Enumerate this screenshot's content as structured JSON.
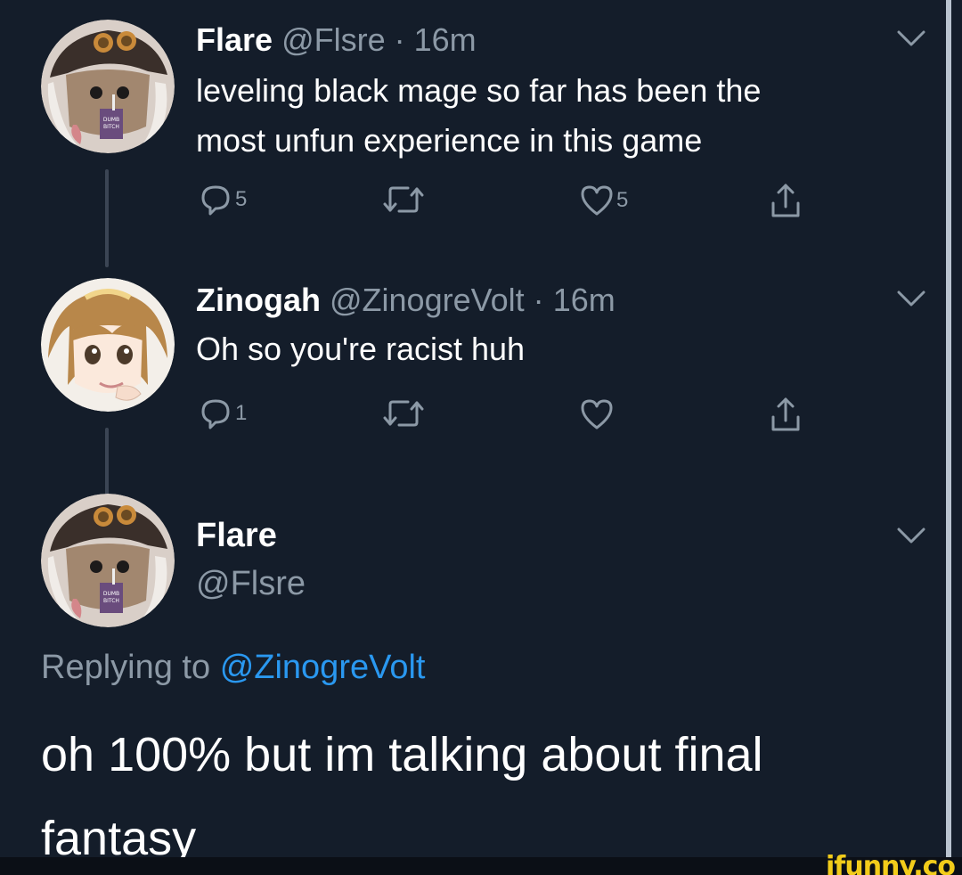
{
  "tweet1": {
    "name": "Flare",
    "handle": "@Flsre",
    "separator": "·",
    "time": "16m",
    "text_line1": "leveling black mage so far has been the",
    "text_line2": "most unfun experience in this game",
    "reply_count": "5",
    "like_count": "5",
    "avatar_label": "DUMB BITCH JUICE"
  },
  "tweet2": {
    "name": "Zinogah",
    "handle": "@ZinogreVolt",
    "separator": "·",
    "time": "16m",
    "text": "Oh so you're racist huh",
    "reply_count": "1"
  },
  "tweet3": {
    "name": "Flare",
    "handle": "@Flsre",
    "replying_prefix": "Replying to",
    "replying_mention": "@ZinogreVolt",
    "text_line1": "oh 100% but im talking about final",
    "text_line2": "fantasy",
    "avatar_label": "DUMB BITCH JUICE"
  },
  "watermark": "ifunny.co",
  "colors": {
    "background": "#141d2a",
    "secondary_text": "#8c99a6",
    "mention": "#2a98f0",
    "watermark": "#f2cc1a"
  },
  "icons": {
    "reply": "reply-bubble-icon",
    "retweet": "retweet-icon",
    "like": "heart-icon",
    "share": "share-icon",
    "menu": "chevron-down-icon"
  }
}
